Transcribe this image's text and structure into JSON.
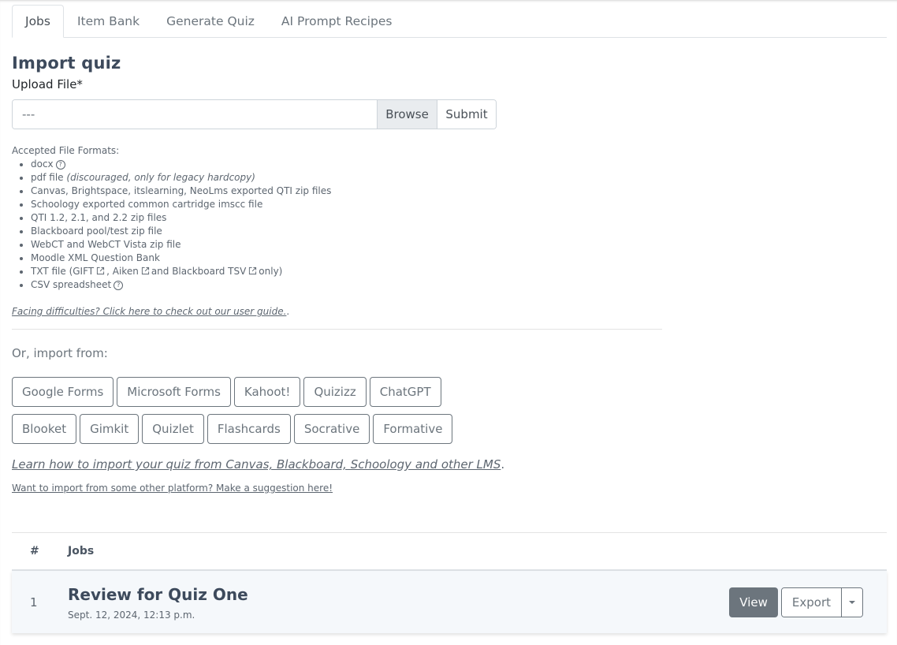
{
  "tabs": [
    {
      "label": "Jobs",
      "active": true
    },
    {
      "label": "Item Bank",
      "active": false
    },
    {
      "label": "Generate Quiz",
      "active": false
    },
    {
      "label": "AI Prompt Recipes",
      "active": false
    }
  ],
  "import": {
    "title": "Import quiz",
    "upload_label": "Upload File*",
    "file_value": "---",
    "browse_label": "Browse",
    "submit_label": "Submit",
    "formats_heading": "Accepted File Formats:",
    "formats": {
      "docx": "docx",
      "pdf": "pdf file",
      "pdf_note": "(discouraged, only for legacy hardcopy)",
      "canvas": "Canvas, Brightspace, itslearning, NeoLms exported QTI zip files",
      "schoology": "Schoology exported common cartridge imscc file",
      "qti": "QTI 1.2, 2.1, and 2.2 zip files",
      "blackboard": "Blackboard pool/test zip file",
      "webct": "WebCT and WebCT Vista zip file",
      "moodle": "Moodle XML Question Bank",
      "txt_prefix": "TXT file (GIFT",
      "txt_aiken": ", Aiken",
      "txt_bb": "and Blackboard TSV",
      "txt_suffix": "only)",
      "csv": "CSV spreadsheet"
    },
    "help_glyph": "?",
    "guide_link": "Facing difficulties? Click here to check out our user guide.",
    "guide_suffix": ".",
    "or_import": "Or, import from:",
    "platforms_row1": [
      "Google Forms",
      "Microsoft Forms",
      "Kahoot!",
      "Quizizz",
      "ChatGPT"
    ],
    "platforms_row2": [
      "Blooket",
      "Gimkit",
      "Quizlet",
      "Flashcards",
      "Socrative",
      "Formative"
    ],
    "lms_link": "Learn how to import your quiz from Canvas, Blackboard, Schoology and other LMS",
    "lms_suffix": ".",
    "suggest_link": "Want to import from some other platform? Make a suggestion here!"
  },
  "jobs": {
    "headers": {
      "num": "#",
      "jobs": "Jobs"
    },
    "rows": [
      {
        "num": "1",
        "title": "Review for Quiz One",
        "date": "Sept. 12, 2024, 12:13 p.m.",
        "view_label": "View",
        "export_label": "Export"
      }
    ]
  }
}
